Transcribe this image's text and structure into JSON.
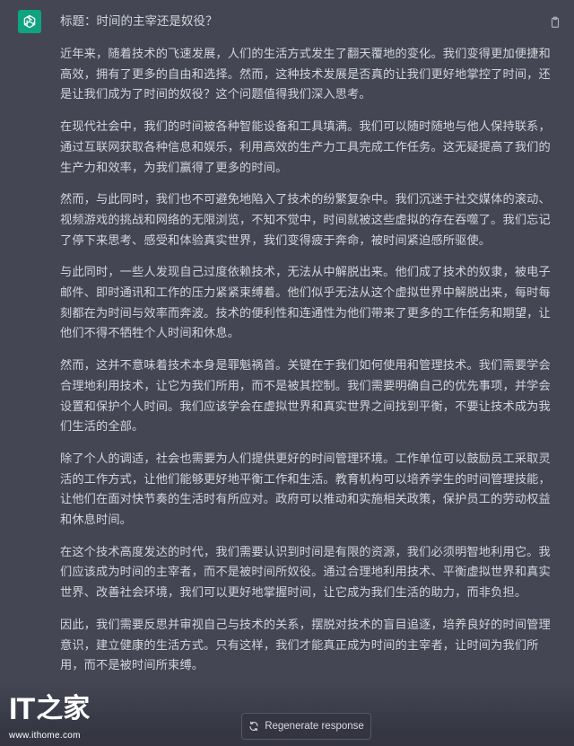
{
  "message": {
    "title": "标题：时间的主宰还是奴役？",
    "paragraphs": [
      "近年来，随着技术的飞速发展，人们的生活方式发生了翻天覆地的变化。我们变得更加便捷和高效，拥有了更多的自由和选择。然而，这种技术发展是否真的让我们更好地掌控了时间，还是让我们成为了时间的奴役？这个问题值得我们深入思考。",
      "在现代社会中，我们的时间被各种智能设备和工具填满。我们可以随时随地与他人保持联系，通过互联网获取各种信息和娱乐，利用高效的生产力工具完成工作任务。这无疑提高了我们的生产力和效率，为我们赢得了更多的时间。",
      "然而，与此同时，我们也不可避免地陷入了技术的纷繁复杂中。我们沉迷于社交媒体的滚动、视频游戏的挑战和网络的无限浏览，不知不觉中，时间就被这些虚拟的存在吞噬了。我们忘记了停下来思考、感受和体验真实世界，我们变得疲于奔命，被时间紧迫感所驱使。",
      "与此同时，一些人发现自己过度依赖技术，无法从中解脱出来。他们成了技术的奴隶，被电子邮件、即时通讯和工作的压力紧紧束缚着。他们似乎无法从这个虚拟世界中解脱出来，每时每刻都在为时间与效率而奔波。技术的便利性和连通性为他们带来了更多的工作任务和期望，让他们不得不牺牲个人时间和休息。",
      "然而，这并不意味着技术本身是罪魁祸首。关键在于我们如何使用和管理技术。我们需要学会合理地利用技术，让它为我们所用，而不是被其控制。我们需要明确自己的优先事项，并学会设置和保护个人时间。我们应该学会在虚拟世界和真实世界之间找到平衡，不要让技术成为我们生活的全部。",
      "除了个人的调适，社会也需要为人们提供更好的时间管理环境。工作单位可以鼓励员工采取灵活的工作方式，让他们能够更好地平衡工作和生活。教育机构可以培养学生的时间管理技能，让他们在面对快节奏的生活时有所应对。政府可以推动和实施相关政策，保护员工的劳动权益和休息时间。",
      "在这个技术高度发达的时代，我们需要认识到时间是有限的资源，我们必须明智地利用它。我们应该成为时间的主宰者，而不是被时间所奴役。通过合理地利用技术、平衡虚拟世界和真实世界、改善社会环境，我们可以更好地掌握时间，让它成为我们生活的助力，而非负担。",
      "因此，我们需要反思并审视自己与技术的关系，摆脱对技术的盲目追逐，培养良好的时间管理意识，建立健康的生活方式。只有这样，我们才能真正成为时间的主宰者，让时间为我们所用，而不是被时间所束缚。"
    ]
  },
  "regenerate_label": "Regenerate response",
  "watermark": {
    "logo_latin": "IT",
    "logo_cn": "之家",
    "url": "www.ithome.com"
  },
  "colors": {
    "background": "#444654",
    "text": "#d1d5db",
    "avatar": "#10a37f",
    "button_bg": "#343541",
    "button_border": "#565869"
  },
  "icons": {
    "avatar": "chatgpt-logo-icon",
    "copy": "clipboard-icon",
    "regenerate": "refresh-icon"
  }
}
